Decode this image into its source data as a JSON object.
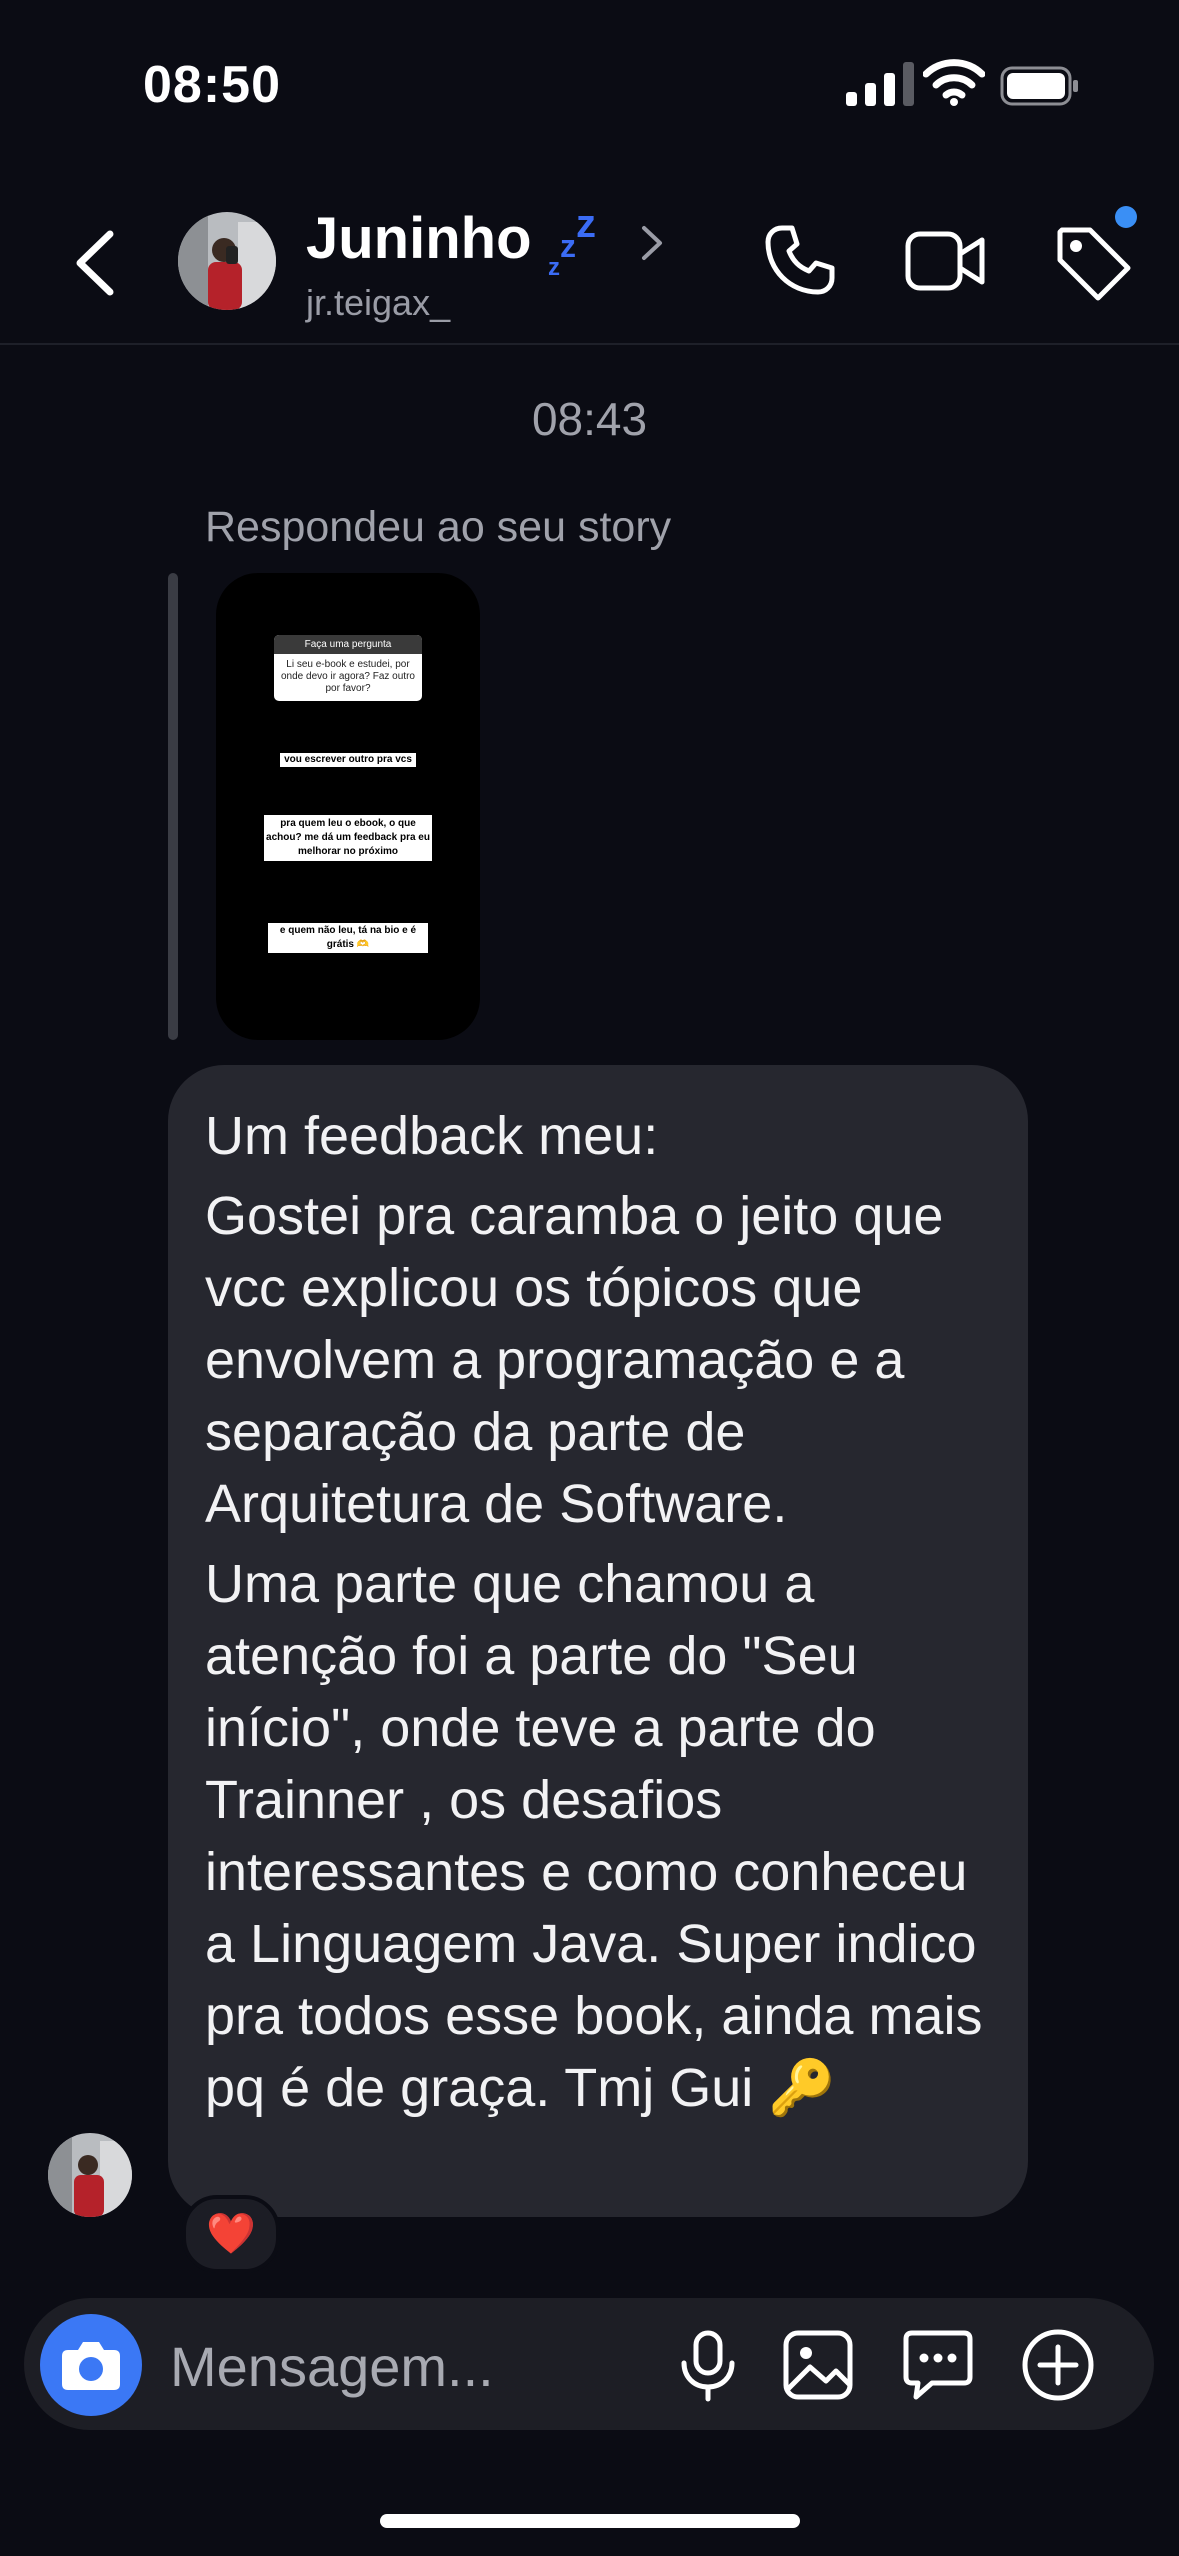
{
  "status_bar": {
    "time": "08:50"
  },
  "header": {
    "name": "Juninho",
    "sleep_indicator": "zzz",
    "username": "jr.teigax_",
    "notification_dot_color": "#3a8ff5"
  },
  "chat": {
    "timestamp": "08:43",
    "reply_label": "Respondeu ao seu story",
    "story": {
      "question_header": "Faça uma pergunta",
      "question": "Li seu e-book e estudei, por onde devo ir agora? Faz outro por favor?",
      "sticker_1": "vou escrever outro pra vcs",
      "sticker_2": "pra quem leu o ebook, o que achou? me dá um feedback pra eu melhorar no próximo",
      "sticker_3": "e quem não leu, tá na bio e é grátis 🫶"
    },
    "message": {
      "p1": "Um feedback meu:",
      "p2": "Gostei pra caramba o jeito que vcc explicou os tópicos que envolvem a programação e a separação da parte de Arquitetura de Software.",
      "p3": "Uma parte que chamou a atenção foi a parte do \"Seu início\", onde teve a parte do Trainner , os desafios interessantes e como conheceu a Linguagem Java. Super indico pra todos esse book, ainda mais pq é de graça. Tmj Gui 🔑"
    },
    "reaction": "❤️"
  },
  "composer": {
    "placeholder": "Mensagem..."
  },
  "colors": {
    "accent": "#3b78f5",
    "bubble": "#26272f",
    "background": "#0b0c14"
  }
}
